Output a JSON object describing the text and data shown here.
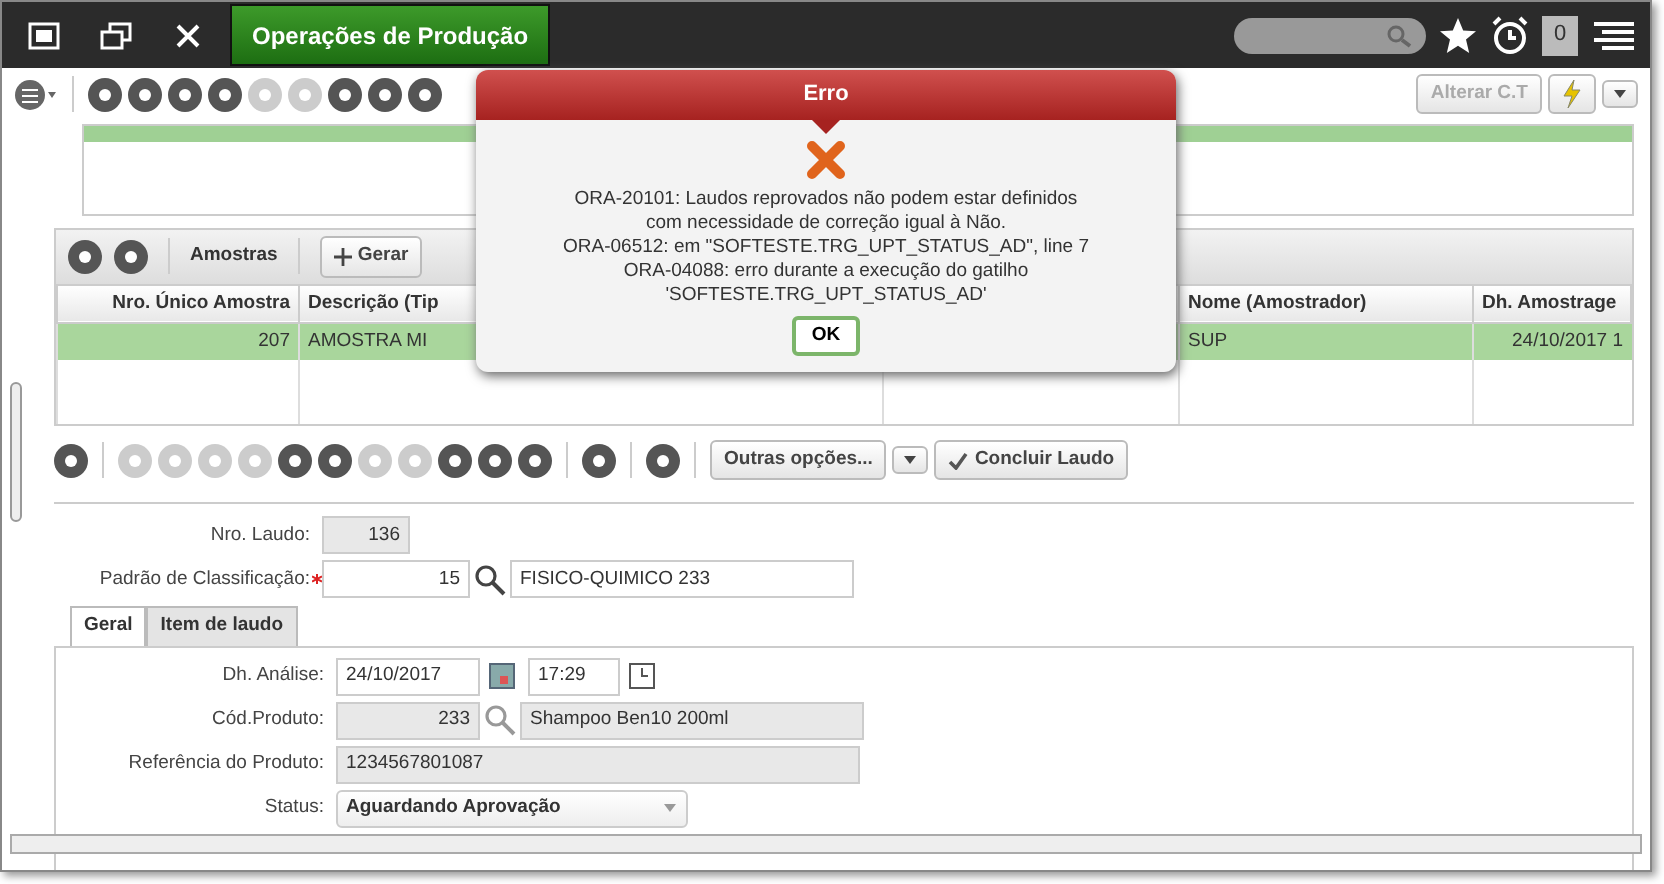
{
  "top_bar": {
    "title": "Operações de Produção",
    "notification_count": "0"
  },
  "main_toolbar": {
    "buttons": [
      {
        "label": "Alterar C.T",
        "disabled": true
      }
    ]
  },
  "samples": {
    "toolbar": {
      "label": "Amostras",
      "button": "Gerar"
    },
    "columns": [
      {
        "label": "Nro. Único Amostra"
      },
      {
        "label": "Descrição (Tip"
      },
      {
        "label": "Nome (Amostrador)"
      },
      {
        "label": "Dh. Amostrage"
      }
    ],
    "rows": [
      {
        "cells": [
          "207",
          "AMOSTRA MI",
          "SUP",
          "24/10/2017 1"
        ],
        "selected": true
      }
    ]
  },
  "detail_toolbar": {
    "options_button": "Outras opções...",
    "conclude_button": "Concluir Laudo"
  },
  "form": {
    "laudo_label": "Nro. Laudo:",
    "laudo_value": "136",
    "standard_label": "Padrão de Classificação:",
    "standard_required": true,
    "standard_code": "15",
    "standard_name": "FISICO-QUIMICO 233",
    "tabs": [
      {
        "label": "Geral",
        "selected": true
      },
      {
        "label": "Item de laudo",
        "selected": false
      }
    ],
    "fields": [
      {
        "kind": "datetime",
        "label": "Dh. Análise:",
        "value": "24/10/2017",
        "value2": "17:29"
      },
      {
        "kind": "lookup",
        "label": "Cód.Produto:",
        "value": "233",
        "value2": "Shampoo Ben10 200ml"
      },
      {
        "kind": "readonly",
        "label": "Referência do Produto:",
        "value": "1234567801087"
      },
      {
        "kind": "select",
        "label": "Status:",
        "value": "Aguardando Aprovação"
      }
    ]
  },
  "error_dialog": {
    "title": "Erro",
    "message_lines": [
      "ORA-20101: Laudos reprovados não podem estar definidos",
      "com necessidade de correção igual à Não.",
      "ORA-06512: em \"SOFTESTE.TRG_UPT_STATUS_AD\", line 7",
      "ORA-04088: erro durante a execução do gatilho",
      "'SOFTESTE.TRG_UPT_STATUS_AD'"
    ],
    "button": "OK"
  }
}
